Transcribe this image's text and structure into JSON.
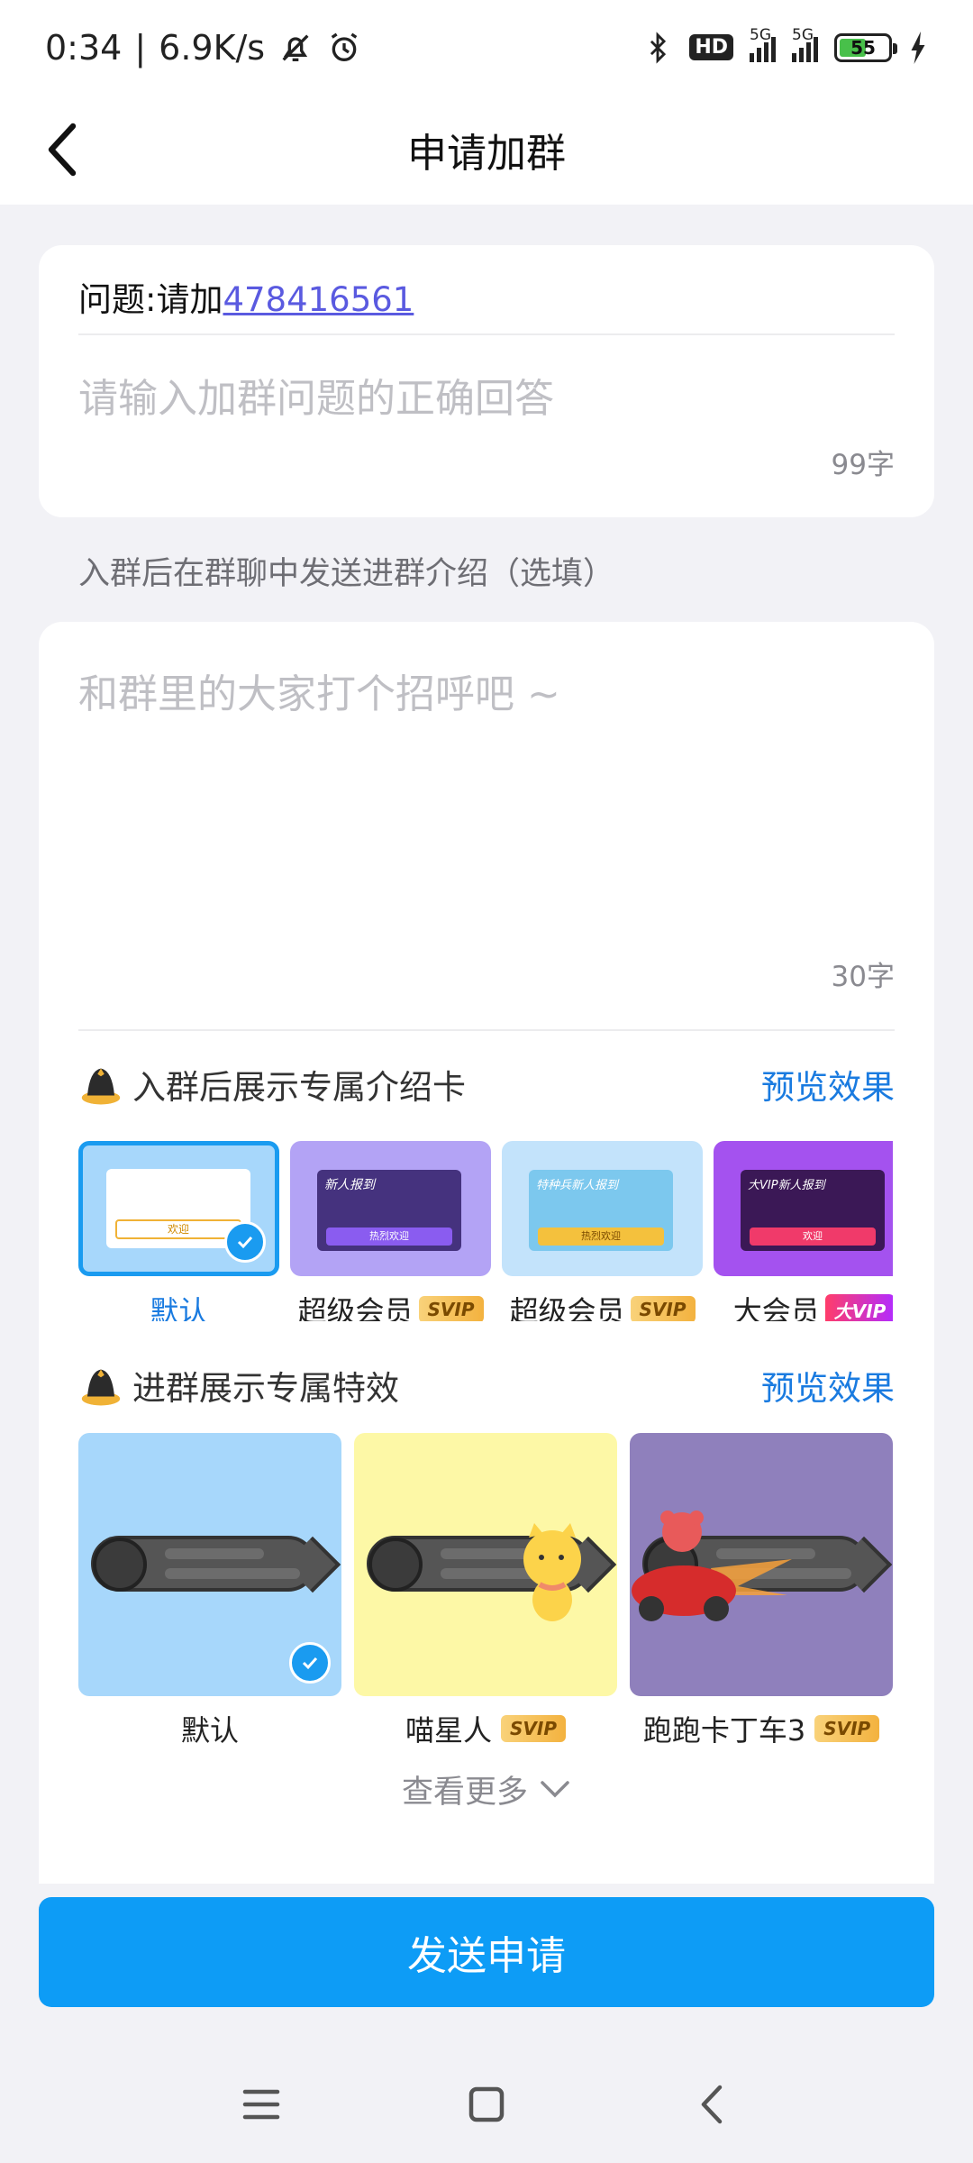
{
  "status": {
    "time": "0:34",
    "speed": "6.9K/s",
    "net": "5G",
    "battery": "55"
  },
  "nav": {
    "title": "申请加群"
  },
  "question": {
    "prefix": "问题:请加",
    "link": "478416561",
    "answer_placeholder": "请输入加群问题的正确回答",
    "counter": "99字"
  },
  "intro": {
    "label": "入群后在群聊中发送进群介绍（选填）",
    "placeholder": "和群里的大家打个招呼吧 ~",
    "counter": "30字"
  },
  "card_section": {
    "title": "入群后展示专属介绍卡",
    "preview": "预览效果",
    "items": [
      {
        "label": "默认",
        "badge": "",
        "selected": true,
        "inner_text": "欢迎"
      },
      {
        "label": "超级会员",
        "badge": "SVIP",
        "inner_title": "新人报到",
        "inner_text": "热烈欢迎"
      },
      {
        "label": "超级会员",
        "badge": "SVIP",
        "inner_title": "特种兵新人报到",
        "inner_text": "热烈欢迎"
      },
      {
        "label": "大会员",
        "badge": "大VIP",
        "inner_title": "大VIP新人报到",
        "inner_text": "欢迎"
      }
    ]
  },
  "effect_section": {
    "title": "进群展示专属特效",
    "preview": "预览效果",
    "items": [
      {
        "label": "默认",
        "badge": "",
        "selected": true,
        "bg": "#a7d7fb"
      },
      {
        "label": "喵星人",
        "badge": "SVIP",
        "bg": "#fdf8a6"
      },
      {
        "label": "跑跑卡丁车3",
        "badge": "SVIP",
        "bg": "#8f80bc"
      }
    ],
    "more": "查看更多"
  },
  "send_button": "发送申请",
  "colors": {
    "accent": "#0d9cf6",
    "link": "#5a5ae0",
    "preview": "#1a7be0"
  }
}
